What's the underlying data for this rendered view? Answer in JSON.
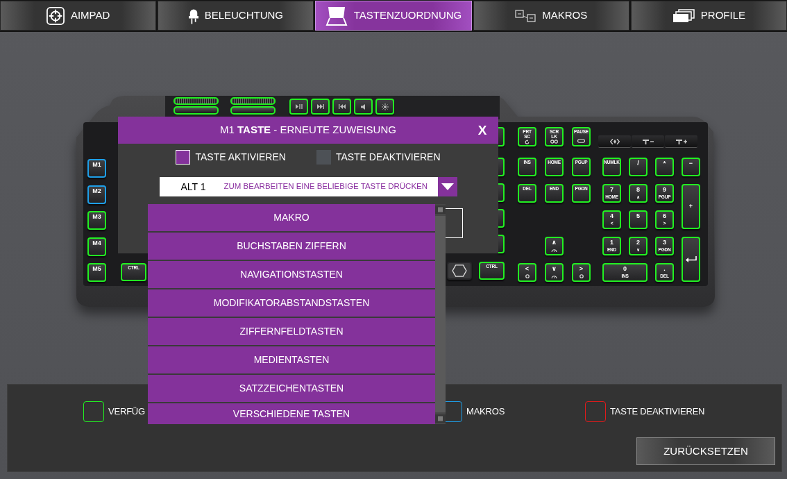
{
  "tabs": [
    {
      "label": "AIMPAD",
      "selected": false
    },
    {
      "label": "BELEUCHTUNG",
      "selected": false
    },
    {
      "label": "TASTENZUORDNUNG",
      "selected": true
    },
    {
      "label": "MAKROS",
      "selected": false
    },
    {
      "label": "PROFILE",
      "selected": false
    }
  ],
  "keyboard": {
    "wheels": [
      {
        "kind": "wheel",
        "color": "#22f022"
      },
      {
        "kind": "wheel",
        "color": "#22f022"
      },
      {
        "kind": "bar",
        "color": "#22f022"
      },
      {
        "kind": "bar",
        "color": "#22f022"
      }
    ],
    "media_keys": [
      {
        "color": "#22f022"
      },
      {
        "color": "#22f022"
      },
      {
        "color": "#22f022"
      },
      {
        "color": "#22f022"
      },
      {
        "color": "#22f022"
      }
    ],
    "macro_keys": [
      {
        "label": "M1",
        "color": "#1e9fe8"
      },
      {
        "label": "M2",
        "color": "#1e9fe8"
      },
      {
        "label": "M3",
        "color": "#22f022"
      },
      {
        "label": "M4",
        "color": "#22f022"
      },
      {
        "label": "M5",
        "color": "#22f022"
      }
    ],
    "left_keys": [
      {
        "label": "CTRL",
        "color": "#22f022"
      }
    ],
    "edge_keys": [
      {
        "color": "#22f022"
      },
      {
        "color": "#22f022"
      },
      {
        "color": "#22f022"
      },
      {
        "color": "#22f022"
      },
      {
        "color": "#22f022"
      }
    ],
    "right_keys": [
      {
        "kind": "logo"
      },
      {
        "kind": "key",
        "label": "CTRL",
        "color": "#22f022"
      }
    ],
    "system_keys": [
      {
        "label": "PRT SC",
        "color": "#22f022"
      },
      {
        "label": "SCR LK",
        "color": "#22f022"
      },
      {
        "label": "PAUSE",
        "color": "#22f022"
      }
    ],
    "nav_keys": [
      {
        "kind": "key",
        "label": "INS",
        "color": "#22f022"
      },
      {
        "kind": "key",
        "label": "HOME",
        "color": "#22f022"
      },
      {
        "kind": "key",
        "label": "PGUP",
        "color": "#22f022"
      },
      {
        "kind": "key",
        "label": "DEL",
        "color": "#22f022"
      },
      {
        "kind": "key",
        "label": "END",
        "color": "#22f022"
      },
      {
        "kind": "key",
        "label": "PGDN",
        "color": "#22f022"
      },
      {
        "kind": "arrow",
        "label": "∧",
        "color": "#22f022"
      },
      {
        "kind": "arrow",
        "label": "<",
        "color": "#22f022"
      },
      {
        "kind": "arrow",
        "label": "∨",
        "color": "#22f022"
      },
      {
        "kind": "arrow",
        "label": ">",
        "color": "#22f022"
      }
    ],
    "numpad": [
      {
        "kind": "key",
        "label": "NUMLK",
        "color": "#22f022"
      },
      {
        "kind": "digit",
        "label": "/",
        "color": "#22f022"
      },
      {
        "kind": "digit",
        "label": "*",
        "color": "#22f022"
      },
      {
        "kind": "digit",
        "label": "−",
        "color": "#22f022"
      },
      {
        "kind": "digit",
        "label": "7",
        "sub": "HOME",
        "color": "#22f022"
      },
      {
        "kind": "digit",
        "label": "8",
        "sub": "∧",
        "color": "#22f022"
      },
      {
        "kind": "digit",
        "label": "9",
        "sub": "PGUP",
        "color": "#22f022"
      },
      {
        "kind": "tall",
        "label": "+",
        "color": "#22f022"
      },
      {
        "kind": "digit",
        "label": "4",
        "sub": "<",
        "color": "#22f022"
      },
      {
        "kind": "digit",
        "label": "5",
        "color": "#22f022"
      },
      {
        "kind": "digit",
        "label": "6",
        "sub": ">",
        "color": "#22f022"
      },
      {
        "kind": "digit",
        "label": "1",
        "sub": "END",
        "color": "#22f022"
      },
      {
        "kind": "digit",
        "label": "2",
        "sub": "∨",
        "color": "#22f022"
      },
      {
        "kind": "digit",
        "label": "3",
        "sub": "PGDN",
        "color": "#22f022"
      },
      {
        "kind": "enter",
        "color": "#22f022"
      },
      {
        "kind": "wide",
        "label": "0",
        "sub": "INS",
        "color": "#22f022"
      },
      {
        "kind": "digit",
        "label": ".",
        "sub": "DEL",
        "color": "#22f022"
      }
    ]
  },
  "dialog": {
    "title": "M1 **TASTE** - ERNEUTE ZUWEISUNG",
    "close": "X",
    "options": [
      {
        "label": "TASTE AKTIVIEREN",
        "selected": true
      },
      {
        "label": "TASTE DEAKTIVIEREN",
        "selected": false
      }
    ],
    "key_field": {
      "label": "ALT 1",
      "placeholder": "ZUM BEARBEITEN EINE BELIEBIGE TASTE DRÜCKEN"
    },
    "dropdown": {
      "expanded": true,
      "items": [
        "MAKRO",
        "BUCHSTABEN ZIFFERN",
        "NAVIGATIONSTASTEN",
        "MODIFIKATORABSTANDSTASTEN",
        "ZIFFERNFELDTASTEN",
        "MEDIENTASTEN",
        "SATZZEICHENTASTEN",
        "VERSCHIEDENE TASTEN"
      ]
    }
  },
  "legend": [
    {
      "label": "VERFÜG",
      "color": "#22f022"
    },
    {
      "label": "MAKROS",
      "color": "#1e9fe8"
    },
    {
      "label": "TASTE DEAKTIVIEREN",
      "color": "#e01b1b"
    }
  ],
  "reset_button": "ZURÜCKSETZEN"
}
